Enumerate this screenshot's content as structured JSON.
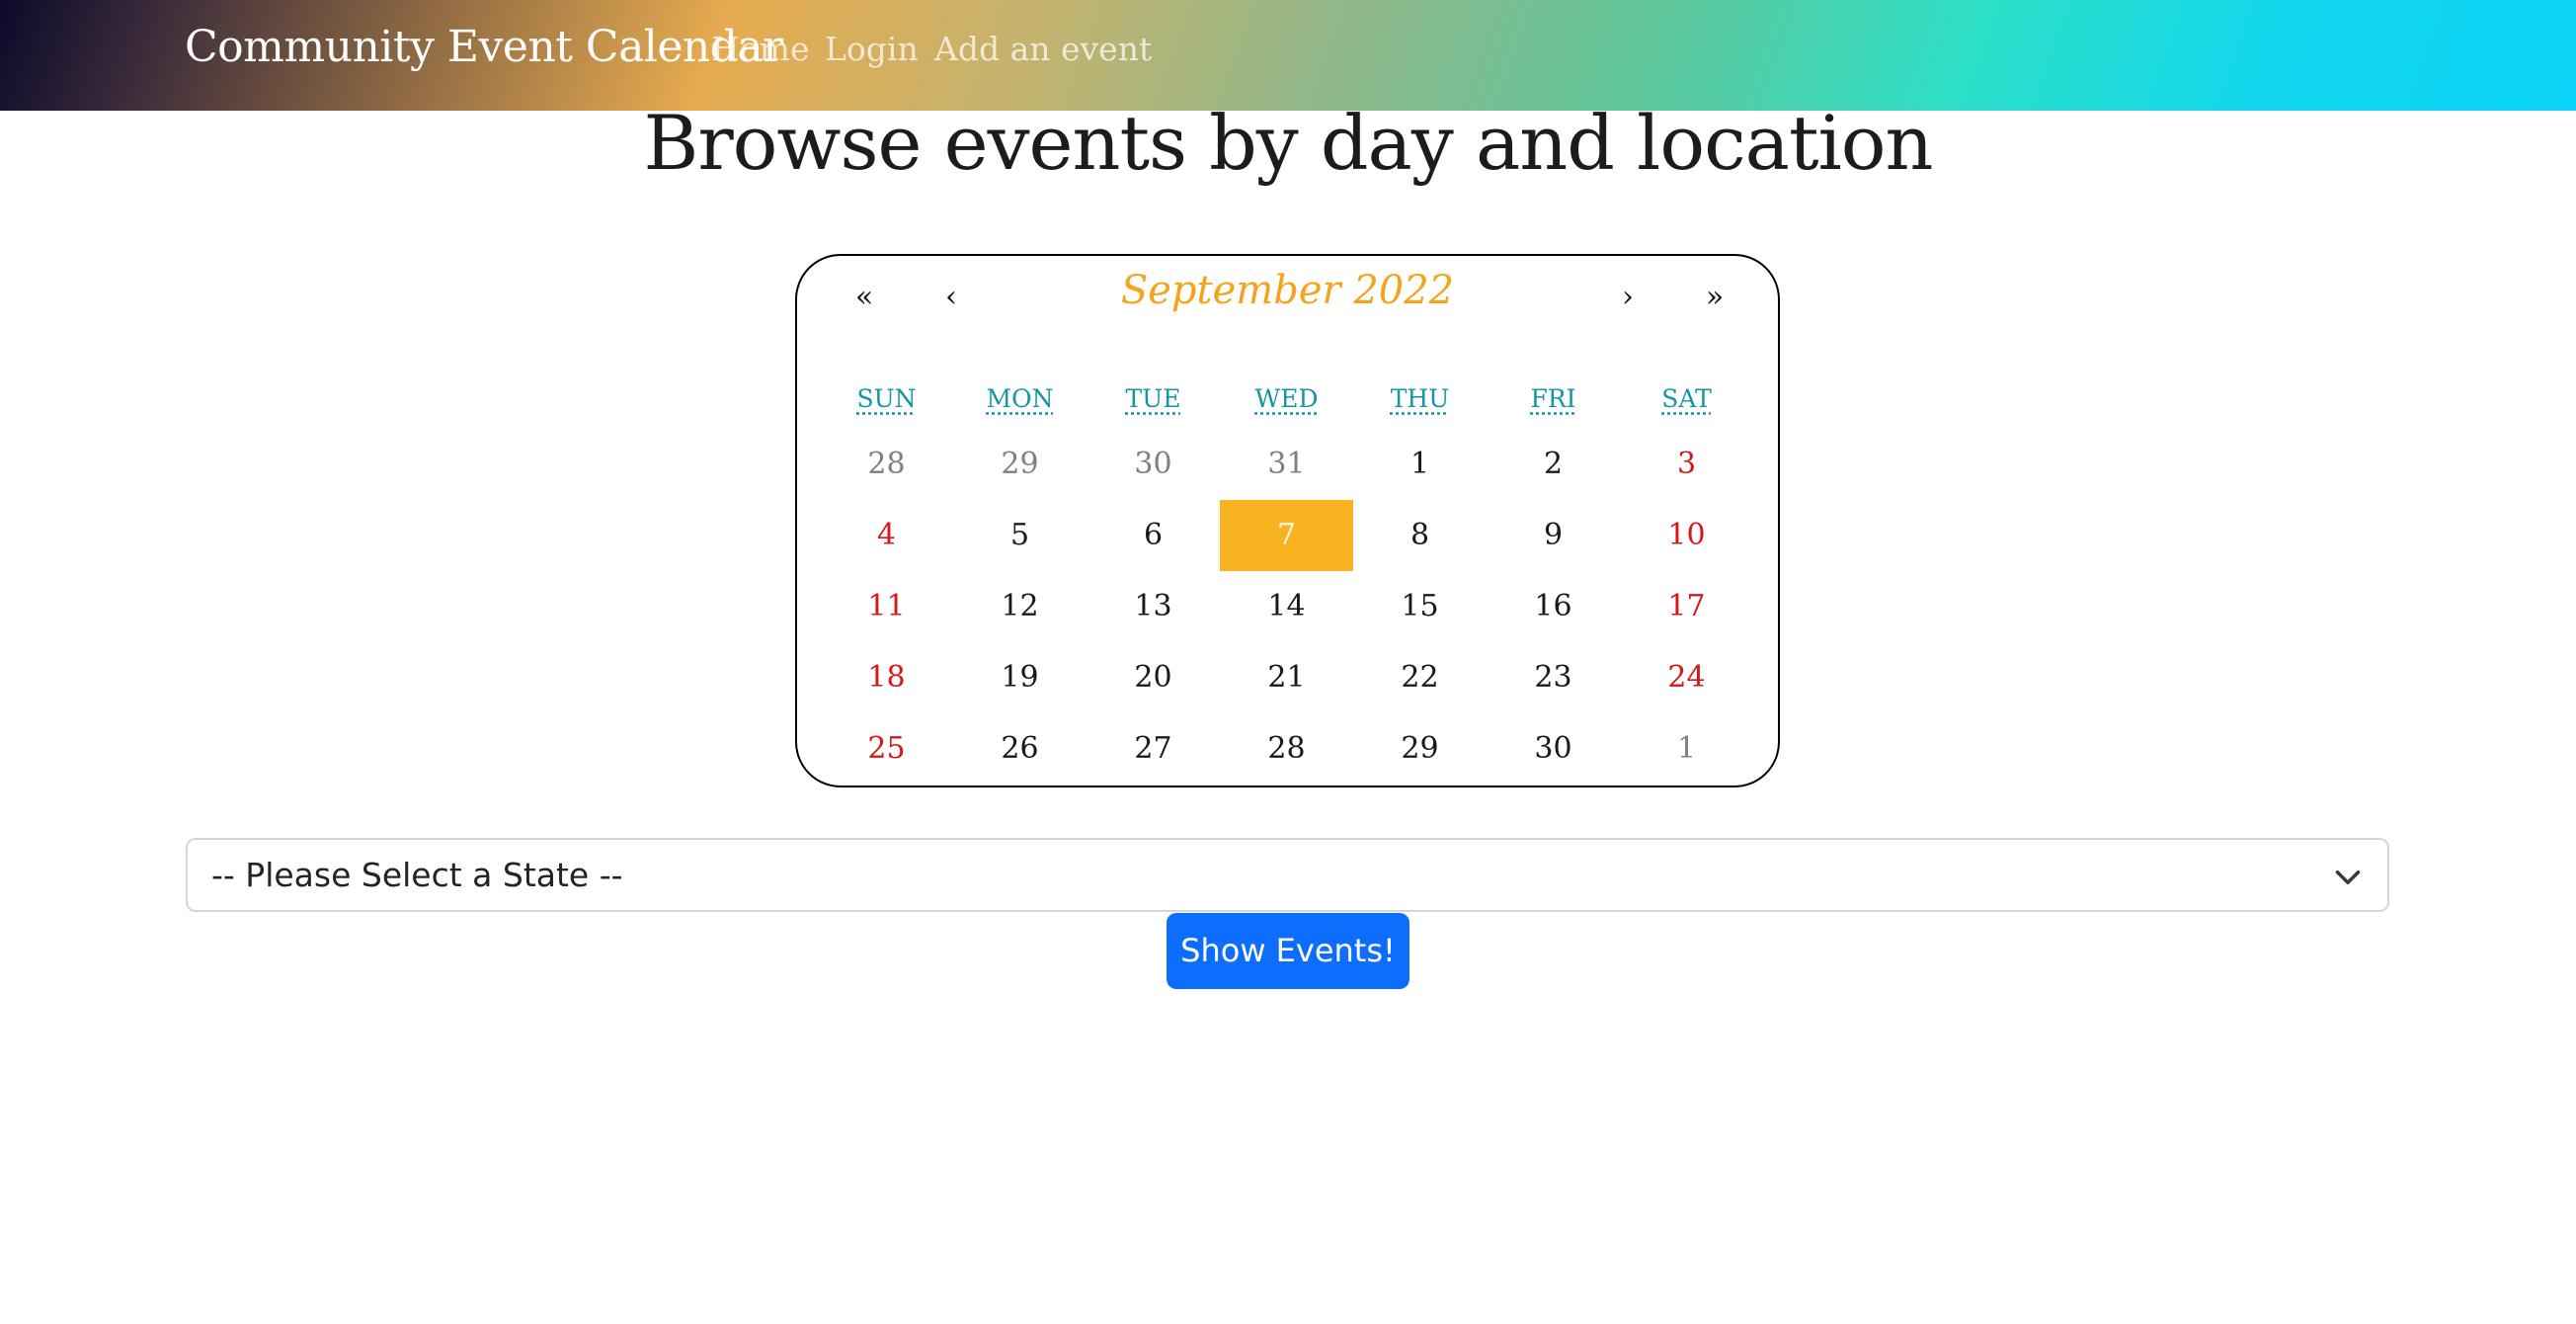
{
  "navbar": {
    "brand": "Community Event Calendar",
    "links": [
      "Home",
      "Login",
      "Add an event"
    ]
  },
  "page": {
    "title": "Browse events by day and location"
  },
  "calendar": {
    "title": "September 2022",
    "nav": {
      "prev_year": "«",
      "prev_month": "‹",
      "next_month": "›",
      "next_year": "»"
    },
    "weekdays": [
      "SUN",
      "MON",
      "TUE",
      "WED",
      "THU",
      "FRI",
      "SAT"
    ],
    "weeks": [
      [
        "28",
        "29",
        "30",
        "31",
        "1",
        "2",
        "3"
      ],
      [
        "4",
        "5",
        "6",
        "7",
        "8",
        "9",
        "10"
      ],
      [
        "11",
        "12",
        "13",
        "14",
        "15",
        "16",
        "17"
      ],
      [
        "18",
        "19",
        "20",
        "21",
        "22",
        "23",
        "24"
      ],
      [
        "25",
        "26",
        "27",
        "28",
        "29",
        "30",
        "1"
      ]
    ],
    "selected_day": "7",
    "colors": {
      "title": "#f3a41a",
      "weekday": "#1496a5",
      "weekend": "#d61818",
      "selected_bg": "#fab320",
      "muted": "#808080"
    }
  },
  "state_select": {
    "selected": "-- Please Select a State --"
  },
  "actions": {
    "show_events": "Show Events!"
  }
}
